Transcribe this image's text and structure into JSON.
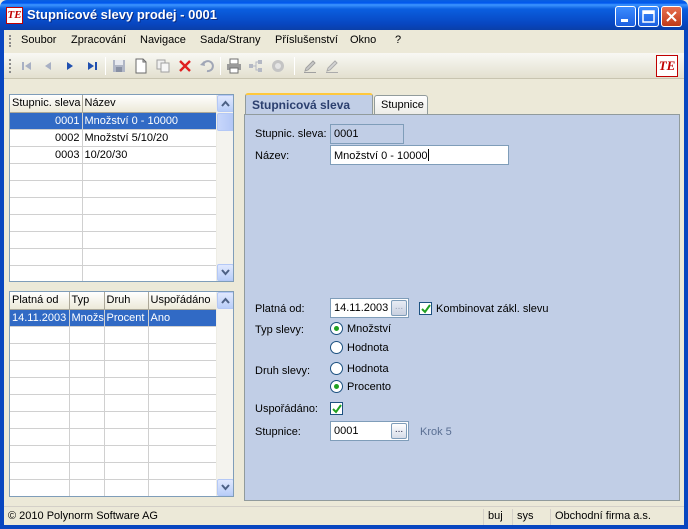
{
  "window": {
    "title": "Stupnicové slevy prodej - 0001",
    "app_logo_text": "TE"
  },
  "menu": [
    "Soubor",
    "Zpracování",
    "Navigace",
    "Sada/Strany",
    "Příslušenství",
    "Okno",
    "?"
  ],
  "toolbar": {
    "icons": [
      "first-record-icon",
      "prev-record-icon",
      "next-record-icon",
      "last-record-icon",
      "save-icon",
      "new-icon",
      "copy-icon",
      "delete-icon",
      "undo-icon",
      "print-icon",
      "tree-icon",
      "disabled-icon",
      "edit-icon",
      "edit-alt-icon"
    ],
    "logo_text": "TE"
  },
  "grid_top": {
    "columns": [
      "Stupnic. sleva",
      "Název"
    ],
    "rows": [
      {
        "code": "0001",
        "name": "Množství 0 - 10000",
        "selected": true
      },
      {
        "code": "0002",
        "name": "Množství 5/10/20",
        "selected": false
      },
      {
        "code": "0003",
        "name": "10/20/30",
        "selected": false
      }
    ]
  },
  "grid_bottom": {
    "columns": [
      "Platná od",
      "Typ",
      "Druh",
      "Uspořádáno"
    ],
    "rows": [
      {
        "platna_od": "14.11.2003",
        "typ": "Množs",
        "druh": "Procent",
        "usporadano": "Ano",
        "selected": true
      }
    ]
  },
  "tabs": [
    {
      "label": "Stupnicová sleva",
      "active": true
    },
    {
      "label": "Stupnice",
      "active": false
    }
  ],
  "form": {
    "stupnic_sleva_label": "Stupnic. sleva:",
    "stupnic_sleva_value": "0001",
    "nazev_label": "Název:",
    "nazev_value": "Množství 0 - 10000",
    "platna_od_label": "Platná od:",
    "platna_od_value": "14.11.2003",
    "kombinovat_label": "Kombinovat zákl. slevu",
    "kombinovat_checked": true,
    "typ_slevy_label": "Typ slevy:",
    "typ_options": [
      {
        "label": "Množství",
        "selected": true
      },
      {
        "label": "Hodnota",
        "selected": false
      }
    ],
    "druh_slevy_label": "Druh slevy:",
    "druh_options": [
      {
        "label": "Hodnota",
        "selected": false
      },
      {
        "label": "Procento",
        "selected": true
      }
    ],
    "usporadano_label": "Uspořádáno:",
    "usporadano_checked": true,
    "stupnice_label": "Stupnice:",
    "stupnice_value": "0001",
    "krok_text": "Krok 5",
    "ellipsis": "..."
  },
  "status": {
    "copyright": "© 2010 Polynorm Software AG",
    "user": "buj",
    "system": "sys",
    "company": "Obchodní firma a.s."
  },
  "colors": {
    "titlebar": "#0A5FE0",
    "selection": "#316AC5",
    "panel": "#C1CEE6",
    "krok_text": "#5A6F93",
    "delete_icon": "#E02020"
  }
}
